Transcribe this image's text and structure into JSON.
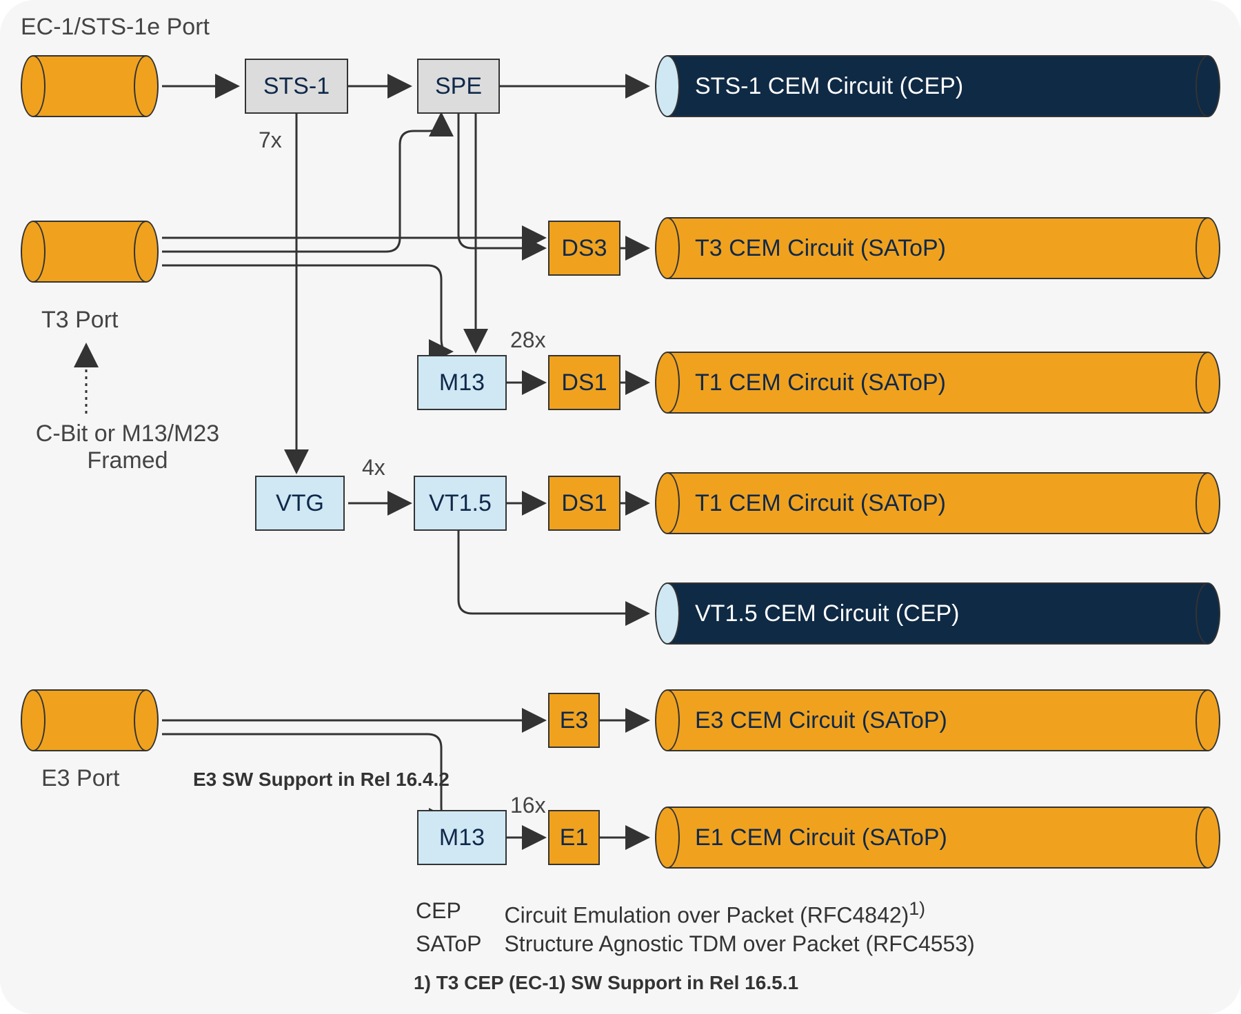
{
  "title": "EC-1/STS-1e Port",
  "ports": {
    "t3": "T3 Port",
    "e3": "E3 Port"
  },
  "framing_note": "C-Bit or M13/M23\nFramed",
  "e3_note": "E3 SW Support in Rel 16.4.2",
  "multipliers": {
    "sts_to_vtg": "7x",
    "vtg_to_vt15": "4x",
    "m13_to_ds1": "28x",
    "m13_to_e1": "16x"
  },
  "boxes": {
    "sts1": "STS-1",
    "spe": "SPE",
    "vtg": "VTG",
    "vt15": "VT1.5",
    "m13_top": "M13",
    "m13_bottom": "M13",
    "ds3": "DS3",
    "ds1_a": "DS1",
    "ds1_b": "DS1",
    "e3": "E3",
    "e1": "E1"
  },
  "circuits": {
    "sts1": "STS-1 CEM Circuit (CEP)",
    "t3": "T3 CEM Circuit (SAToP)",
    "t1_a": "T1 CEM Circuit (SAToP)",
    "t1_b": "T1 CEM Circuit (SAToP)",
    "vt15": "VT1.5 CEM Circuit (CEP)",
    "e3": "E3 CEM Circuit (SAToP)",
    "e1": "E1 CEM Circuit (SAToP)"
  },
  "legend": {
    "cep_key": "CEP",
    "cep_val": "Circuit Emulation over Packet (RFC4842)",
    "cep_sup": "1)",
    "satop_key": "SAToP",
    "satop_val": "Structure Agnostic TDM over Packet (RFC4553)"
  },
  "footnote": "1) T3 CEP (EC-1) SW Support in Rel 16.5.1"
}
